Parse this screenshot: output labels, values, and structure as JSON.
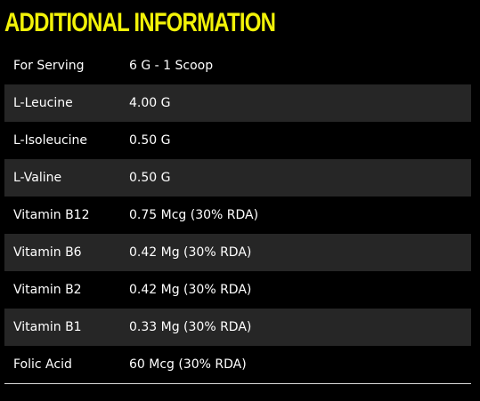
{
  "section": {
    "title": "ADDITIONAL INFORMATION",
    "accent_color": "#f2f208",
    "shaded_row_color": "#262626"
  },
  "rows": [
    {
      "label": "For Serving",
      "value": "6 G - 1 Scoop"
    },
    {
      "label": "L-Leucine",
      "value": "4.00 G"
    },
    {
      "label": "L-Isoleucine",
      "value": "0.50 G"
    },
    {
      "label": "L-Valine",
      "value": "0.50 G"
    },
    {
      "label": "Vitamin B12",
      "value": "0.75 Mcg (30% RDA)"
    },
    {
      "label": "Vitamin B6",
      "value": "0.42 Mg (30% RDA)"
    },
    {
      "label": "Vitamin B2",
      "value": "0.42 Mg (30% RDA)"
    },
    {
      "label": "Vitamin B1",
      "value": "0.33 Mg (30% RDA)"
    },
    {
      "label": "Folic Acid",
      "value": "60 Mcg (30% RDA)"
    }
  ]
}
